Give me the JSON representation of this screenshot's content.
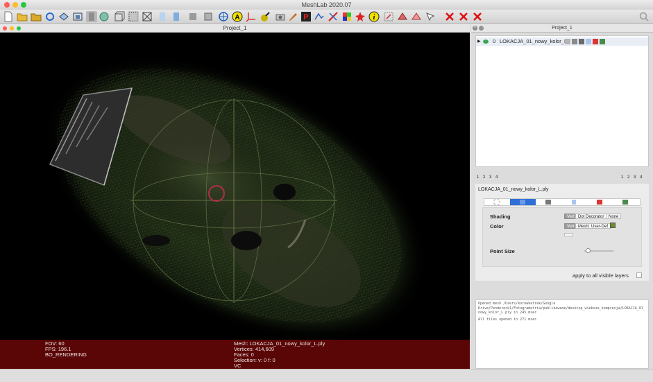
{
  "window": {
    "title": "MeshLab 2020.07"
  },
  "colors": {
    "statusbar": "#5a0606",
    "selected_tab": "#2f6fd6",
    "vertex_color_swatch": "#6b8e23"
  },
  "toolbar": {
    "icons": [
      "new-document-icon",
      "open-folder-icon",
      "open-project-icon",
      "reload-icon",
      "export-mesh-icon",
      "snapshot-icon",
      "view-mode-icon",
      "trackball-icon",
      "bbox-icon",
      "points-mode-icon",
      "wireframe-icon",
      "hidden-lines-icon",
      "flat-shading-icon",
      "smooth-shading-icon",
      "texture-icon",
      "light-icon",
      "annotate-a-icon",
      "axis-icon",
      "selection-icon",
      "camera-icon",
      "paint-icon",
      "pick-points-icon",
      "align-icon",
      "measure-icon",
      "color-icon",
      "georef-icon",
      "info-icon",
      "select-vertex-icon",
      "select-faces-icon",
      "select-connected-icon",
      "select-none-icon",
      "delete-vertices-icon",
      "delete-faces-icon",
      "delete-selection-icon",
      "search-icon"
    ]
  },
  "viewport": {
    "title": "Project_1",
    "fov_line": "FOV: 60",
    "fps_line": "FPS:   196.1",
    "render_line": "BO_RENDERING",
    "mesh_line": "Mesh: LOKACJA_01_nowy_kolor_L.ply",
    "vertices_line": "Vertices: 414,609",
    "faces_line": "Faces: 0",
    "selection_line": "Selection: v: 0 f: 0",
    "vc_line": "VC"
  },
  "layers_panel": {
    "title": "Project_1",
    "layer": {
      "index": "0",
      "name": "LOKACJA_01_nowy_kolor_L"
    },
    "tab_numbers_left": [
      "1",
      "2",
      "3",
      "4"
    ],
    "tab_numbers_right": [
      "1",
      "2",
      "3",
      "4"
    ]
  },
  "decorators": {
    "mesh_name": "LOKACJA_01_nowy_kolor_L.ply",
    "shading_label": "Shading",
    "color_label": "Color",
    "point_size_label": "Point Size",
    "point_size_value": 0.12,
    "shading_options": [
      "Vert",
      "Dot Decorator",
      "None"
    ],
    "shading_selected": "Vert",
    "color_options": [
      "Vert",
      "Mesh",
      "User-Def"
    ],
    "color_selected": "Vert",
    "apply_label": "apply to all visible layers"
  },
  "log": {
    "line1": "Opened mesh /Users/korowkatrek/Google Drive/Pendereck1/Fotogrametria/publikowane/desktop_wieksza_kompresja/LOKACJA_01_nowy_kolor_L.ply in 245 msec",
    "line2": "All files opened in 271 msec"
  }
}
